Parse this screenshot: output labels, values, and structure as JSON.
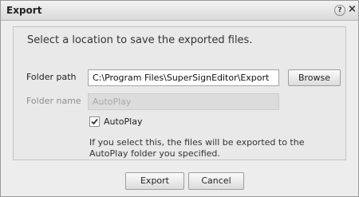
{
  "window": {
    "title": "Export",
    "help_symbol": "?",
    "close_symbol": "×"
  },
  "panel": {
    "instruction": "Select a location to save the exported files.",
    "folder_path": {
      "label": "Folder path",
      "value": "C:\\Program Files\\SuperSignEditor\\Export",
      "browse_label": "Browse"
    },
    "folder_name": {
      "label": "Folder name",
      "placeholder": "AutoPlay",
      "enabled": false
    },
    "autoplay": {
      "label": "AutoPlay",
      "checked": true
    },
    "note": "If you select this, the files will be exported to the AutoPlay folder you specified."
  },
  "footer": {
    "export_label": "Export",
    "cancel_label": "Cancel"
  },
  "icons": {
    "help": "help-icon",
    "close": "close-icon",
    "check": "checkmark-icon"
  }
}
